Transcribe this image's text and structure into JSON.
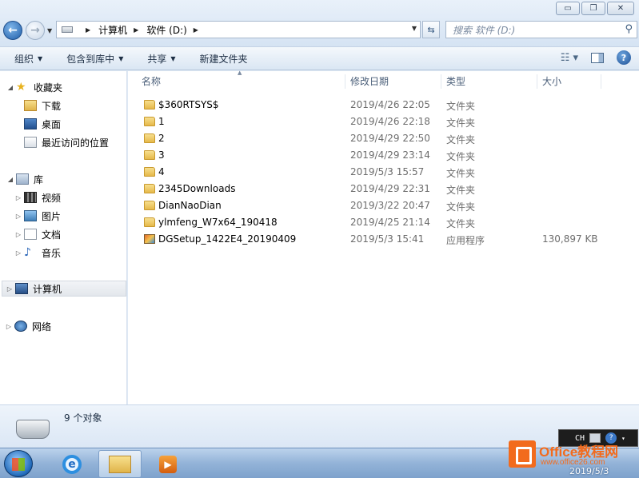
{
  "window": {
    "minimize_glyph": "▭",
    "maximize_glyph": "❐",
    "close_glyph": "✕"
  },
  "nav": {
    "back_glyph": "←",
    "forward_glyph": "→"
  },
  "address": {
    "breadcrumbs": [
      "计算机",
      "软件 (D:)"
    ],
    "search_placeholder": "搜索 软件 (D:)"
  },
  "toolbar": {
    "organize": "组织",
    "include_in_library": "包含到库中",
    "share": "共享",
    "new_folder": "新建文件夹"
  },
  "sidebar": {
    "favorites": "收藏夹",
    "downloads": "下载",
    "desktop": "桌面",
    "recent": "最近访问的位置",
    "libraries": "库",
    "videos": "视频",
    "pictures": "图片",
    "documents": "文档",
    "music": "音乐",
    "computer": "计算机",
    "network": "网络"
  },
  "columns": {
    "name": "名称",
    "modified": "修改日期",
    "type": "类型",
    "size": "大小"
  },
  "files": [
    {
      "name": "$360RTSYS$",
      "modified": "2019/4/26 22:05",
      "type": "文件夹",
      "size": "",
      "icon": "folder-icon"
    },
    {
      "name": "1",
      "modified": "2019/4/26 22:18",
      "type": "文件夹",
      "size": "",
      "icon": "folder-icon"
    },
    {
      "name": "2",
      "modified": "2019/4/29 22:50",
      "type": "文件夹",
      "size": "",
      "icon": "folder-icon"
    },
    {
      "name": "3",
      "modified": "2019/4/29 23:14",
      "type": "文件夹",
      "size": "",
      "icon": "folder-icon"
    },
    {
      "name": "4",
      "modified": "2019/5/3 15:57",
      "type": "文件夹",
      "size": "",
      "icon": "folder-icon"
    },
    {
      "name": "2345Downloads",
      "modified": "2019/4/29 22:31",
      "type": "文件夹",
      "size": "",
      "icon": "folder-icon"
    },
    {
      "name": "DianNaoDian",
      "modified": "2019/3/22 20:47",
      "type": "文件夹",
      "size": "",
      "icon": "folder-icon"
    },
    {
      "name": "ylmfeng_W7x64_190418",
      "modified": "2019/4/25 21:14",
      "type": "文件夹",
      "size": "",
      "icon": "folder-icon"
    },
    {
      "name": "DGSetup_1422E4_20190409",
      "modified": "2019/5/3 15:41",
      "type": "应用程序",
      "size": "130,897 KB",
      "icon": "application-icon"
    }
  ],
  "details": {
    "count": "9 个对象"
  },
  "taskbar": {
    "ie_letter": "e",
    "media_glyph": "▶",
    "clock_date": "2019/5/3"
  },
  "langbar": {
    "lang": "CH",
    "help": "?",
    "arrow": "▾"
  },
  "watermark": {
    "brand": "Office教程网",
    "url": "www.office26.com"
  },
  "colors": {
    "window_bg": "#dfe9f5",
    "taskbar": "#93b3d8",
    "folder": "#e6b84a",
    "watermark": "#f26b1d"
  }
}
